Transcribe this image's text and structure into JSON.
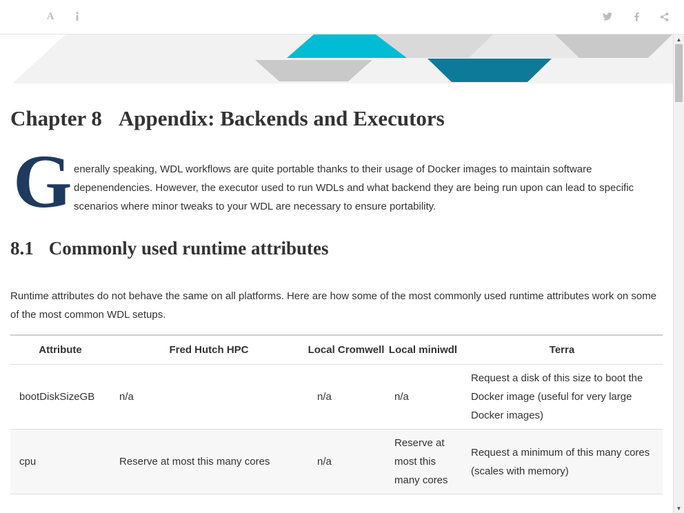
{
  "toolbar": {
    "font_icon_glyph": "A",
    "icons": [
      "font-settings-icon",
      "info-icon",
      "twitter-icon",
      "facebook-icon",
      "share-icon"
    ]
  },
  "chapter": {
    "number": "Chapter 8",
    "title": "Appendix: Backends and Executors",
    "dropcap": "G",
    "intro": "enerally speaking, WDL workflows are quite portable thanks to their usage of Docker images to maintain software depenendencies. However, the executor used to run WDLs and what backend they are being run upon can lead to specific scenarios where minor tweaks to your WDL are necessary to ensure portability."
  },
  "section": {
    "number": "8.1",
    "title": "Commonly used runtime attributes",
    "paragraph": "Runtime attributes do not behave the same on all platforms. Here are how some of the most commonly used runtime attributes work on some of the most common WDL setups."
  },
  "table": {
    "headers": [
      "Attribute",
      "Fred Hutch HPC",
      "Local Cromwell",
      "Local miniwdl",
      "Terra"
    ],
    "rows": [
      [
        "bootDiskSizeGB",
        "n/a",
        "n/a",
        "n/a",
        "Request a disk of this size to boot the Docker image (useful for very large Docker images)"
      ],
      [
        "cpu",
        "Reserve at most this many cores",
        "n/a",
        "Reserve at most this many cores",
        "Request a minimum of this many cores (scales with memory)"
      ]
    ]
  },
  "colors": {
    "accent_cyan": "#00bcd4",
    "accent_teal": "#0e7a99",
    "dropcap": "#1f3a5f"
  }
}
